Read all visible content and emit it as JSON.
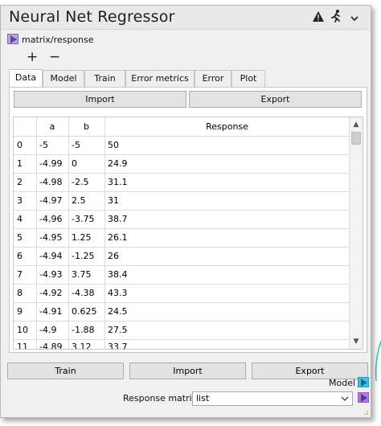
{
  "header": {
    "title": "Neural Net Regressor",
    "icons": [
      "warning-icon",
      "running-person-icon",
      "chevron-down-icon"
    ]
  },
  "input_port": {
    "path_label": "matrix/response"
  },
  "actions": {
    "add_label": "+",
    "remove_label": "−"
  },
  "tabs": [
    {
      "label": "Data",
      "active": true
    },
    {
      "label": "Model",
      "active": false
    },
    {
      "label": "Train",
      "active": false
    },
    {
      "label": "Error metrics",
      "active": false
    },
    {
      "label": "Error",
      "active": false
    },
    {
      "label": "Plot",
      "active": false
    }
  ],
  "data_panel": {
    "import_label": "Import",
    "export_label": "Export",
    "table": {
      "columns": [
        "",
        "a",
        "b",
        "Response"
      ],
      "rows": [
        [
          "0",
          "-5",
          "-5",
          "50"
        ],
        [
          "1",
          "-4.99",
          "0",
          "24.9"
        ],
        [
          "2",
          "-4.98",
          "-2.5",
          "31.1"
        ],
        [
          "3",
          "-4.97",
          "2.5",
          "31"
        ],
        [
          "4",
          "-4.96",
          "-3.75",
          "38.7"
        ],
        [
          "5",
          "-4.95",
          "1.25",
          "26.1"
        ],
        [
          "6",
          "-4.94",
          "-1.25",
          "26"
        ],
        [
          "7",
          "-4.93",
          "3.75",
          "38.4"
        ],
        [
          "8",
          "-4.92",
          "-4.38",
          "43.3"
        ],
        [
          "9",
          "-4.91",
          "0.625",
          "24.5"
        ],
        [
          "10",
          "-4.9",
          "-1.88",
          "27.5"
        ],
        [
          "11",
          "-4.89",
          "3.12",
          "33.7"
        ]
      ]
    }
  },
  "footer": {
    "train_label": "Train",
    "import_label": "Import",
    "export_label": "Export",
    "model_output_label": "Model",
    "response_matrix_label": "Response matrix",
    "response_matrix_value": "list"
  },
  "colors": {
    "input_port": "#b7a4e4",
    "model_port": "#3cc4e6",
    "response_port": "#b07ae0"
  }
}
